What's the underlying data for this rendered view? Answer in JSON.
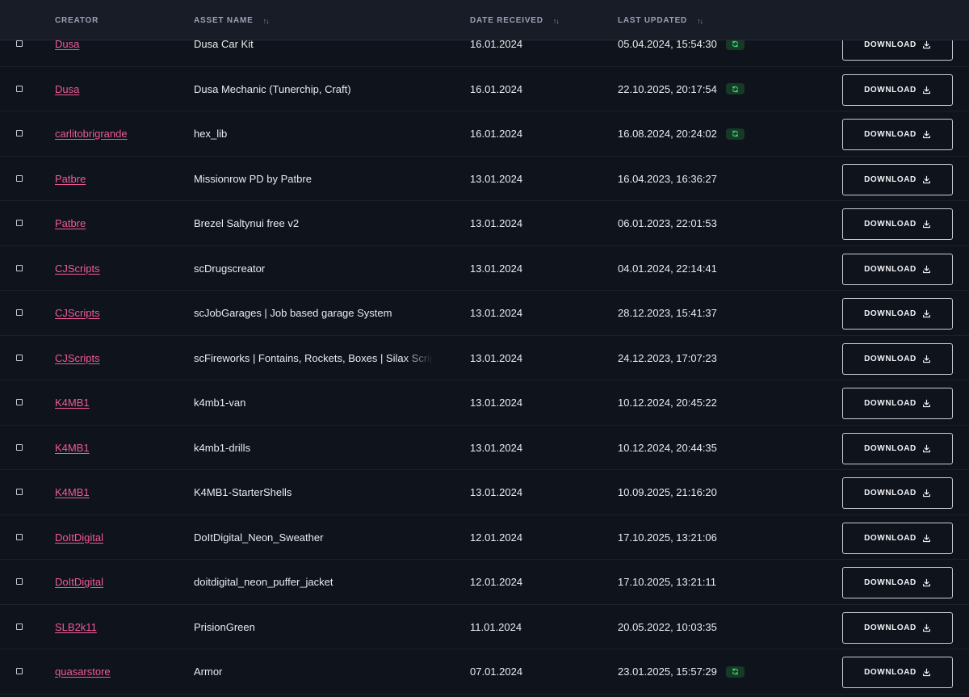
{
  "columns": {
    "creator": "CREATOR",
    "asset_name": "ASSET NAME",
    "date_received": "DATE RECEIVED",
    "last_updated": "LAST UPDATED"
  },
  "download_label": "DOWNLOAD",
  "rows": [
    {
      "creator": "Dusa",
      "asset": "Dusa Car Kit",
      "received": "16.01.2024",
      "updated": "05.04.2024, 15:54:30",
      "update_badge": true
    },
    {
      "creator": "Dusa",
      "asset": "Dusa Mechanic (Tunerchip, Craft)",
      "received": "16.01.2024",
      "updated": "22.10.2025, 20:17:54",
      "update_badge": true
    },
    {
      "creator": "carlitobrigrande",
      "asset": "hex_lib",
      "received": "16.01.2024",
      "updated": "16.08.2024, 20:24:02",
      "update_badge": true
    },
    {
      "creator": "Patbre",
      "asset": "Missionrow PD by Patbre",
      "received": "13.01.2024",
      "updated": "16.04.2023, 16:36:27",
      "update_badge": false
    },
    {
      "creator": "Patbre",
      "asset": "Brezel Saltynui free v2",
      "received": "13.01.2024",
      "updated": "06.01.2023, 22:01:53",
      "update_badge": false
    },
    {
      "creator": "CJScripts",
      "asset": "scDrugscreator",
      "received": "13.01.2024",
      "updated": "04.01.2024, 22:14:41",
      "update_badge": false
    },
    {
      "creator": "CJScripts",
      "asset": "scJobGarages | Job based garage System",
      "received": "13.01.2024",
      "updated": "28.12.2023, 15:41:37",
      "update_badge": false
    },
    {
      "creator": "CJScripts",
      "asset": "scFireworks | Fontains, Rockets, Boxes | Silax Scripts",
      "received": "13.01.2024",
      "updated": "24.12.2023, 17:07:23",
      "update_badge": false
    },
    {
      "creator": "K4MB1",
      "asset": "k4mb1-van",
      "received": "13.01.2024",
      "updated": "10.12.2024, 20:45:22",
      "update_badge": false
    },
    {
      "creator": "K4MB1",
      "asset": "k4mb1-drills",
      "received": "13.01.2024",
      "updated": "10.12.2024, 20:44:35",
      "update_badge": false
    },
    {
      "creator": "K4MB1",
      "asset": "K4MB1-StarterShells",
      "received": "13.01.2024",
      "updated": "10.09.2025, 21:16:20",
      "update_badge": false
    },
    {
      "creator": "DoItDigital",
      "asset": "DoItDigital_Neon_Sweather",
      "received": "12.01.2024",
      "updated": "17.10.2025, 13:21:06",
      "update_badge": false
    },
    {
      "creator": "DoItDigital",
      "asset": "doitdigital_neon_puffer_jacket",
      "received": "12.01.2024",
      "updated": "17.10.2025, 13:21:11",
      "update_badge": false
    },
    {
      "creator": "SLB2k11",
      "asset": "PrisionGreen",
      "received": "11.01.2024",
      "updated": "20.05.2022, 10:03:35",
      "update_badge": false
    },
    {
      "creator": "quasarstore",
      "asset": "Armor",
      "received": "07.01.2024",
      "updated": "23.01.2025, 15:57:29",
      "update_badge": true
    }
  ],
  "icons": {
    "sort": "sort-arrows-icon",
    "update": "refresh-icon",
    "download": "download-icon"
  },
  "colors": {
    "background": "#0f131c",
    "header": "#171c27",
    "creator_link": "#ef5a9a",
    "badge_bg": "#163a26",
    "badge_icon": "#3ccf6e"
  }
}
